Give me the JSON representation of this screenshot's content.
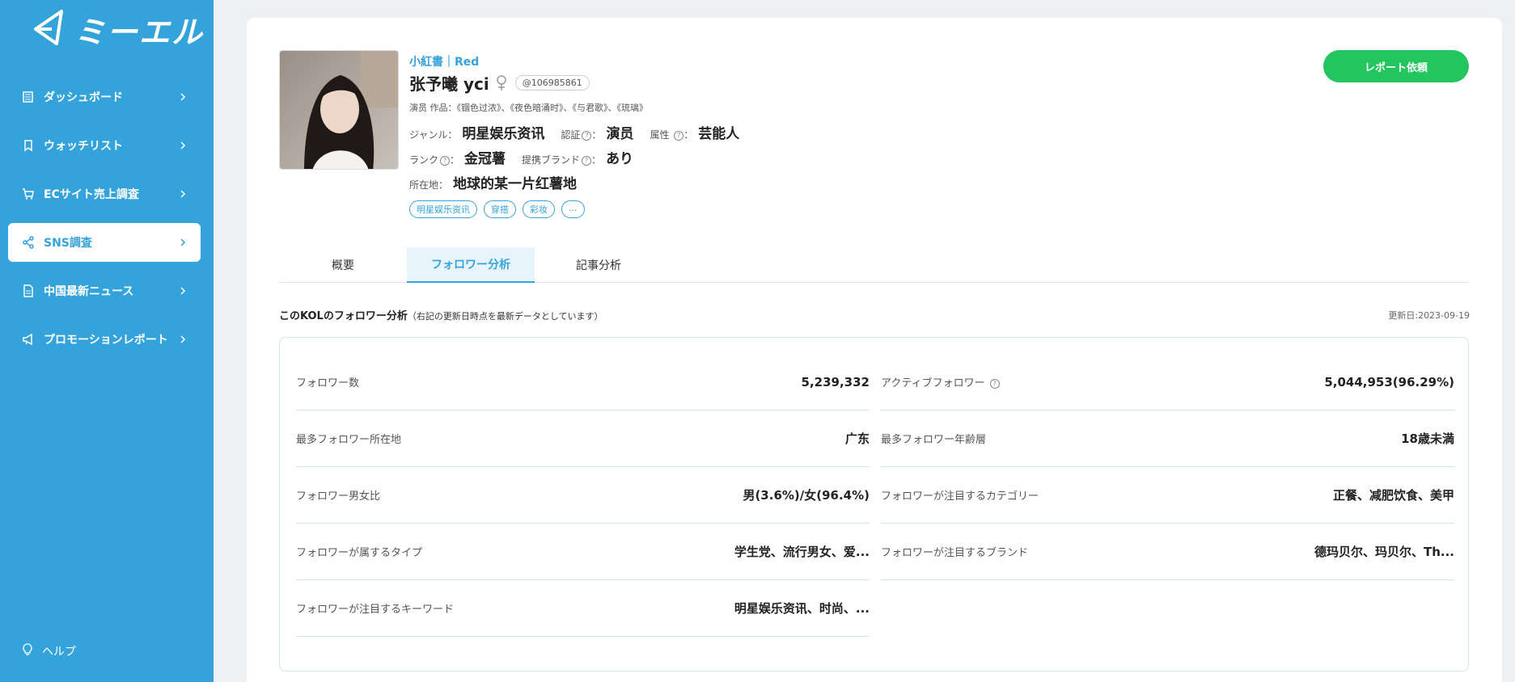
{
  "app": {
    "brand": "ミーエル"
  },
  "sidebar": {
    "items": [
      {
        "label": "ダッシュボード",
        "icon": "newspaper-icon"
      },
      {
        "label": "ウォッチリスト",
        "icon": "bookmark-icon"
      },
      {
        "label": "ECサイト売上調査",
        "icon": "cart-icon"
      },
      {
        "label": "SNS調査",
        "icon": "share-icon",
        "active": true
      },
      {
        "label": "中国最新ニュース",
        "icon": "document-icon"
      },
      {
        "label": "プロモーションレポート",
        "icon": "megaphone-icon"
      }
    ],
    "help": "ヘルプ"
  },
  "profile": {
    "platform": "小紅書｜Red",
    "name": "张予曦 yci",
    "gender": "female",
    "handle": "@106985861",
    "works": "演员 作品：《锢色过浓》、《夜色暗涌时》、《与君歌》、《琉璃》",
    "genre_label": "ジャンル：",
    "genre": "明星娱乐资讯",
    "cert_label": "認証",
    "cert_suffix": "：",
    "cert": "演员",
    "attr_label": "属性",
    "attr_suffix": "：",
    "attr": "芸能人",
    "rank_label": "ランク",
    "rank_suffix": "：",
    "rank": "金冠薯",
    "brand_label": "提携ブランド",
    "brand_suffix": "：",
    "brand": "あり",
    "location_label": "所在地：",
    "location": "地球的某一片红薯地",
    "tags": [
      "明星娱乐资讯",
      "穿搭",
      "彩妆",
      "..."
    ]
  },
  "actions": {
    "report": "レポート依頼"
  },
  "tabs": [
    {
      "label": "概要"
    },
    {
      "label": "フォロワー分析",
      "active": true
    },
    {
      "label": "記事分析"
    }
  ],
  "analysis": {
    "title": "このKOLのフォロワー分析",
    "subtitle": "（右記の更新日時点を最新データとしています）",
    "updated": "更新日:2023-09-19",
    "left": [
      {
        "label": "フォロワー数",
        "value": "5,239,332"
      },
      {
        "label": "最多フォロワー所在地",
        "value": "广东"
      },
      {
        "label": "フォロワー男女比",
        "value": "男(3.6%)/女(96.4%)"
      },
      {
        "label": "フォロワーが属するタイプ",
        "value": "学生党、流行男女、爱..."
      },
      {
        "label": "フォロワーが注目するキーワード",
        "value": "明星娱乐资讯、时尚、..."
      }
    ],
    "right": [
      {
        "label": "アクティブフォロワー",
        "value": "5,044,953(96.29%)"
      },
      {
        "label": "最多フォロワー年齢層",
        "value": "18歳未満"
      },
      {
        "label": "フォロワーが注目するカテゴリー",
        "value": "正餐、减肥饮食、美甲"
      },
      {
        "label": "フォロワーが注目するブランド",
        "value": "德玛贝尔、玛贝尔、Th..."
      }
    ]
  },
  "colors": {
    "sidebar": "#34a3dc",
    "accent": "#34a3dc",
    "report_button": "#22c55e",
    "background": "#eef0f4"
  }
}
